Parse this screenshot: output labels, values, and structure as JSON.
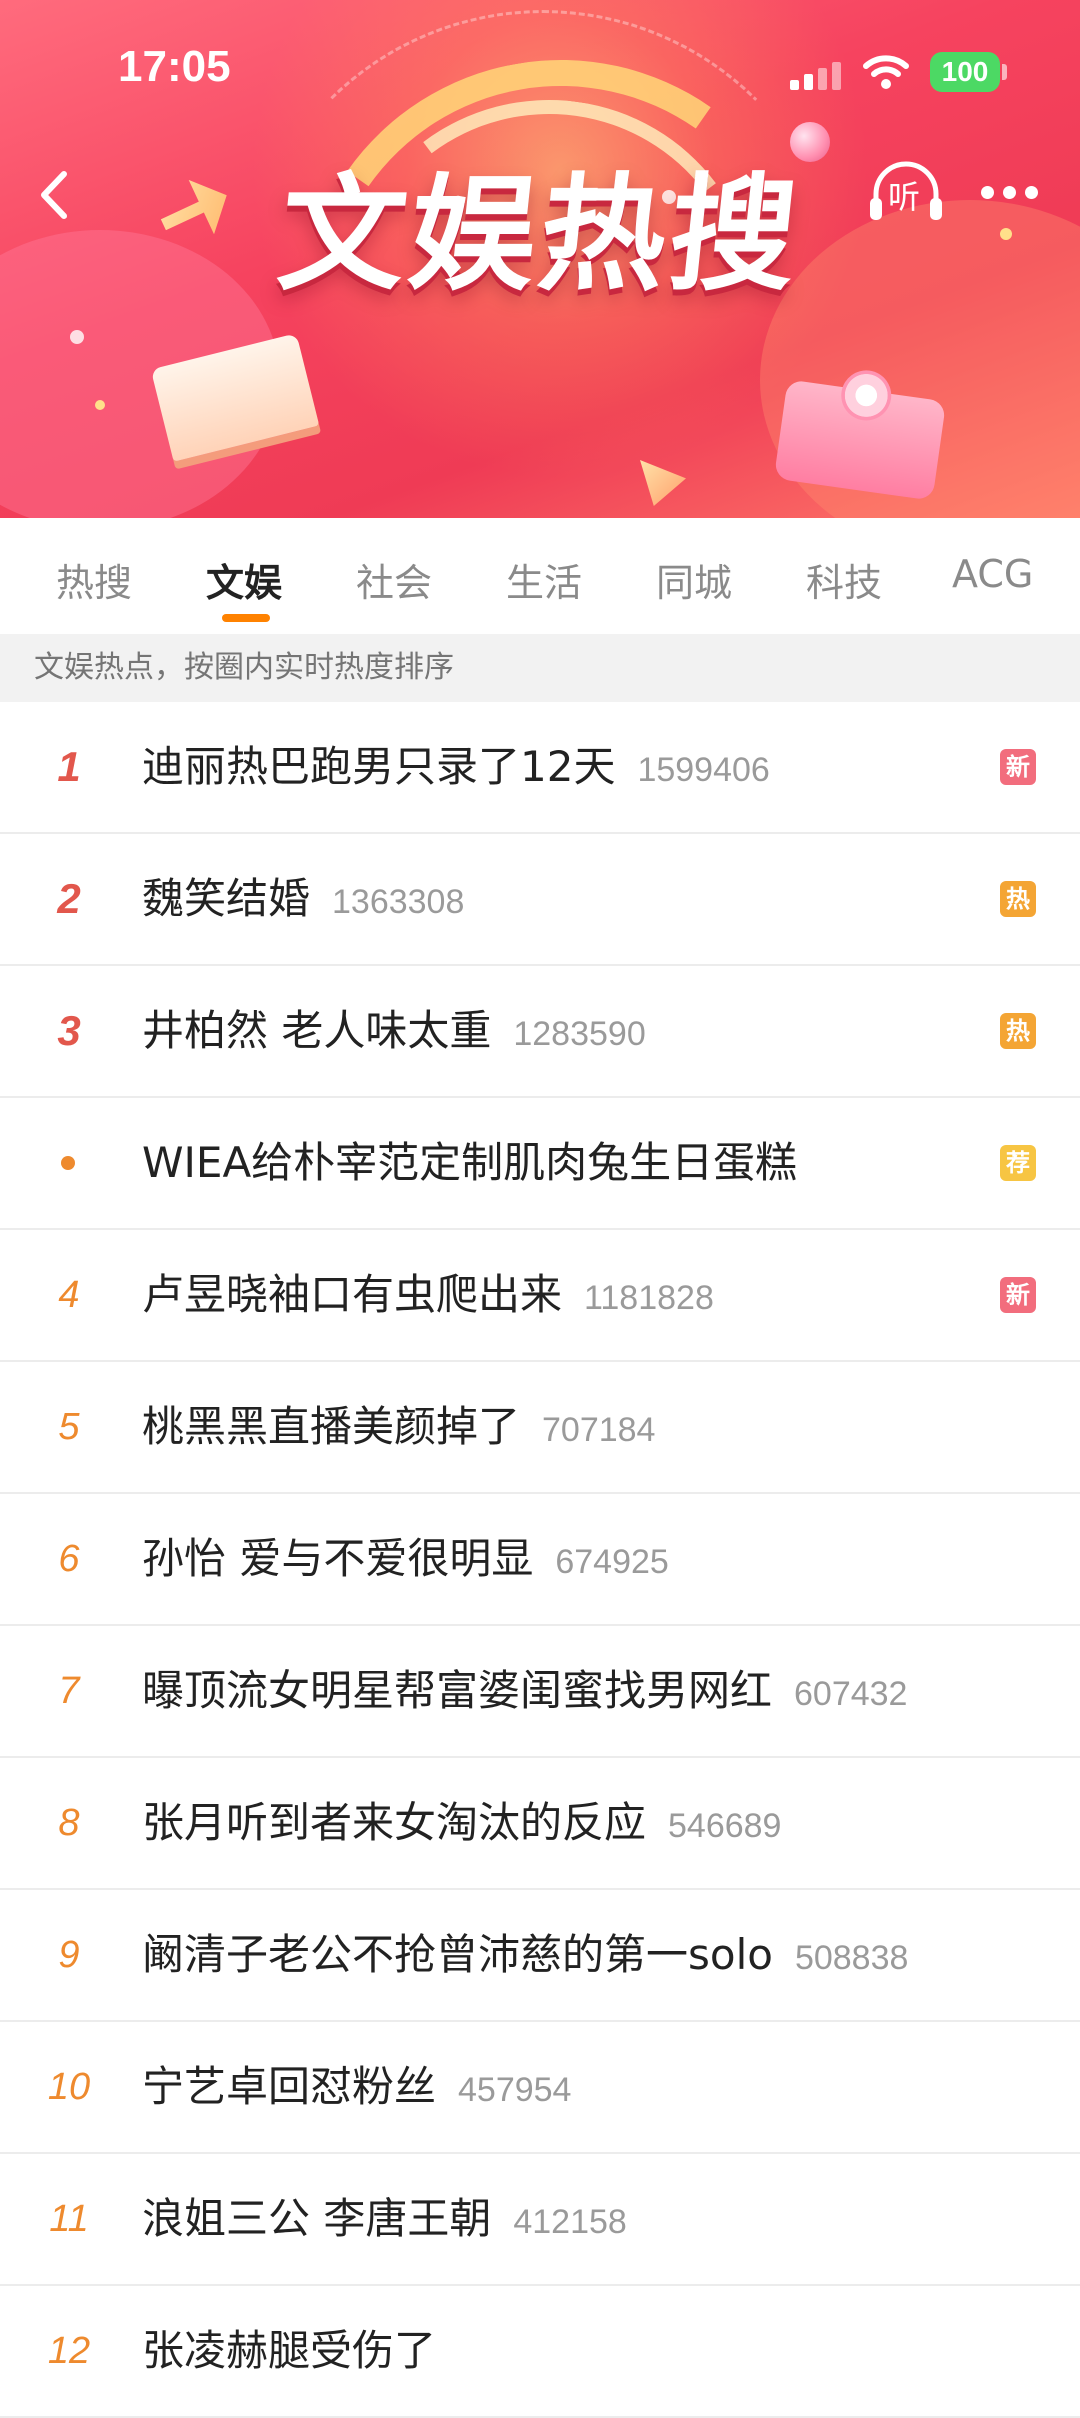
{
  "status_bar": {
    "time": "17:05",
    "battery": "100"
  },
  "header": {
    "banner_title": "文娱热搜",
    "listen_label": "听"
  },
  "tabs": [
    {
      "label": "热搜",
      "active": false
    },
    {
      "label": "文娱",
      "active": true
    },
    {
      "label": "社会",
      "active": false
    },
    {
      "label": "生活",
      "active": false
    },
    {
      "label": "同城",
      "active": false
    },
    {
      "label": "科技",
      "active": false
    },
    {
      "label": "ACG",
      "active": false
    }
  ],
  "subheader": "文娱热点，按圈内实时热度排序",
  "items": [
    {
      "rank": "1",
      "title": "迪丽热巴跑男只录了12天",
      "count": "1599406",
      "badge": "新",
      "badge_type": "new"
    },
    {
      "rank": "2",
      "title": "魏笑结婚",
      "count": "1363308",
      "badge": "热",
      "badge_type": "hot"
    },
    {
      "rank": "3",
      "title": "井柏然 老人味太重",
      "count": "1283590",
      "badge": "热",
      "badge_type": "hot"
    },
    {
      "rank": "",
      "title": "WIEA给朴宰范定制肌肉兔生日蛋糕",
      "count": "",
      "badge": "荐",
      "badge_type": "rec"
    },
    {
      "rank": "4",
      "title": "卢昱晓袖口有虫爬出来",
      "count": "1181828",
      "badge": "新",
      "badge_type": "new"
    },
    {
      "rank": "5",
      "title": "桃黑黑直播美颜掉了",
      "count": "707184",
      "badge": "",
      "badge_type": ""
    },
    {
      "rank": "6",
      "title": "孙怡 爱与不爱很明显",
      "count": "674925",
      "badge": "",
      "badge_type": ""
    },
    {
      "rank": "7",
      "title": "曝顶流女明星帮富婆闺蜜找男网红",
      "count": "607432",
      "badge": "",
      "badge_type": ""
    },
    {
      "rank": "8",
      "title": "张月听到者来女淘汰的反应",
      "count": "546689",
      "badge": "",
      "badge_type": ""
    },
    {
      "rank": "9",
      "title": "阚清子老公不抢曾沛慈的第一solo",
      "count": "508838",
      "badge": "",
      "badge_type": ""
    },
    {
      "rank": "10",
      "title": "宁艺卓回怼粉丝",
      "count": "457954",
      "badge": "",
      "badge_type": ""
    },
    {
      "rank": "11",
      "title": "浪姐三公 李唐王朝",
      "count": "412158",
      "badge": "",
      "badge_type": ""
    },
    {
      "rank": "12",
      "title": "张凌赫腿受伤了",
      "count": "",
      "badge": "",
      "badge_type": ""
    }
  ],
  "colors": {
    "accent": "#ff8200",
    "rank_top": "#e2574c",
    "rank_other": "#ee8a2e"
  }
}
